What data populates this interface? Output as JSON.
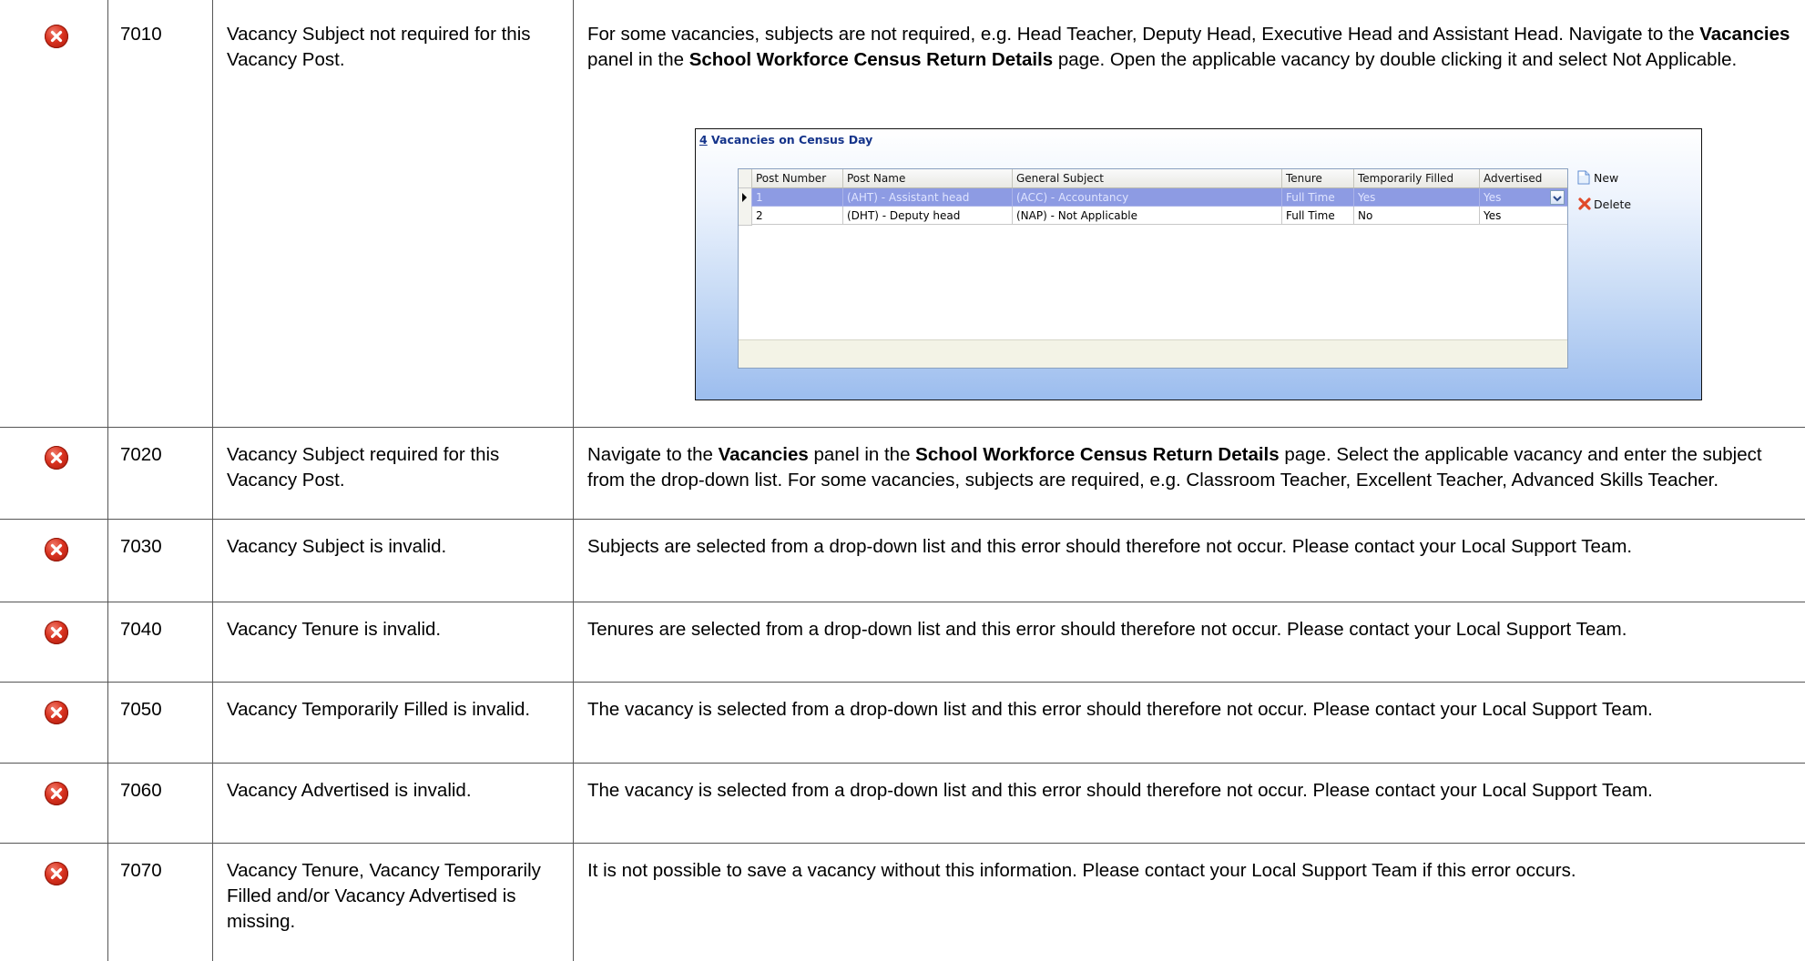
{
  "rows": [
    {
      "code": "7010",
      "message": "Vacancy Subject not required for this Vacancy Post.",
      "solution_parts": [
        {
          "text": "For some vacancies, subjects are not required, e.g. Head Teacher, Deputy Head, Executive Head and Assistant Head. Navigate to the ",
          "bold": false
        },
        {
          "text": "Vacancies",
          "bold": true
        },
        {
          "text": " panel in the ",
          "bold": false
        },
        {
          "text": "School Workforce Census Return Details",
          "bold": true
        },
        {
          "text": " page. Open the applicable vacancy by double clicking it and select Not Applicable.",
          "bold": false
        }
      ]
    },
    {
      "code": "7020",
      "message": "Vacancy Subject required for this Vacancy Post.",
      "solution_parts": [
        {
          "text": "Navigate to the ",
          "bold": false
        },
        {
          "text": "Vacancies",
          "bold": true
        },
        {
          "text": " panel in the ",
          "bold": false
        },
        {
          "text": "School Workforce Census Return Details",
          "bold": true
        },
        {
          "text": " page. Select the applicable vacancy and enter the subject from the drop-down list. For some vacancies, subjects are required, e.g. Classroom Teacher, Excellent Teacher, Advanced Skills Teacher.",
          "bold": false
        }
      ]
    },
    {
      "code": "7030",
      "message": "Vacancy Subject is invalid.",
      "solution_parts": [
        {
          "text": "Subjects are selected from a drop-down list and this error should therefore not occur. Please contact your Local Support Team.",
          "bold": false
        }
      ]
    },
    {
      "code": "7040",
      "message": "Vacancy Tenure is invalid.",
      "solution_parts": [
        {
          "text": "Tenures are selected from a drop-down list and this error should therefore not occur. Please contact your Local Support Team.",
          "bold": false
        }
      ]
    },
    {
      "code": "7050",
      "message": "Vacancy Temporarily Filled is invalid.",
      "solution_parts": [
        {
          "text": "The vacancy is selected from a drop-down list and this error should therefore not occur. Please contact your Local Support Team.",
          "bold": false
        }
      ]
    },
    {
      "code": "7060",
      "message": "Vacancy Advertised is invalid.",
      "solution_parts": [
        {
          "text": "The vacancy is selected from a drop-down list and this error should therefore not occur. Please contact your Local Support Team.",
          "bold": false
        }
      ]
    },
    {
      "code": "7070",
      "message": "Vacancy Tenure, Vacancy Temporarily Filled and/or Vacancy Advertised is missing.",
      "solution_parts": [
        {
          "text": "It is not possible to save a vacancy without this information. Please contact your Local Support Team if this error occurs.",
          "bold": false
        }
      ]
    }
  ],
  "screenshot": {
    "panel_number": "4",
    "panel_title": " Vacancies on Census Day",
    "columns": [
      "Post Number",
      "Post Name",
      "General Subject",
      "Tenure",
      "Temporarily Filled",
      "Advertised"
    ],
    "rows": [
      [
        "1",
        "(AHT) - Assistant head",
        "(ACC) - Accountancy",
        "Full Time",
        "Yes",
        "Yes"
      ],
      [
        "2",
        "(DHT) - Deputy head",
        "(NAP) - Not Applicable",
        "Full Time",
        "No",
        "Yes"
      ]
    ],
    "selected_row": 0,
    "new_label": "New",
    "delete_label": "Delete"
  },
  "icons": {
    "status": "error-icon",
    "new": "new-document-icon",
    "delete": "delete-x-icon",
    "row_pointer": "row-pointer-icon",
    "dropdown": "chevron-down-icon"
  },
  "colors": {
    "error_red": "#d8321f",
    "selected_row": "#8d9be3",
    "panel_title": "#14338a"
  }
}
